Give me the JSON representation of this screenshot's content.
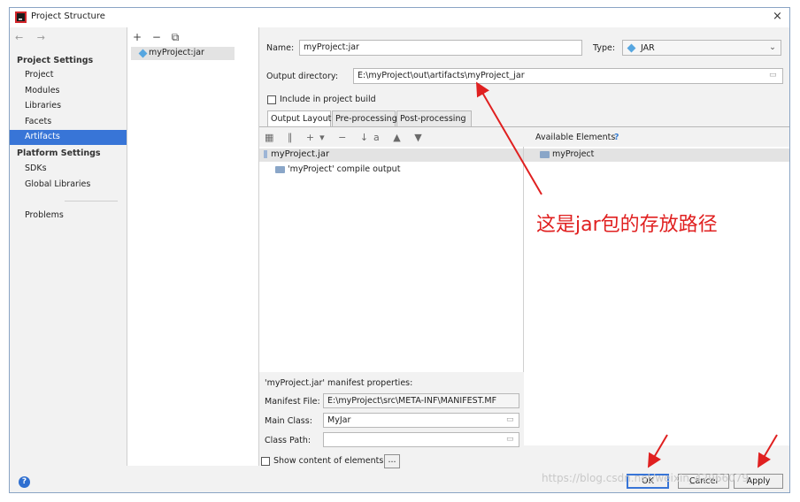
{
  "window": {
    "title": "Project Structure",
    "close_glyph": "×"
  },
  "nav": {
    "back_forward": "← →",
    "project_settings_header": "Project Settings",
    "project_settings": [
      "Project",
      "Modules",
      "Libraries",
      "Facets",
      "Artifacts"
    ],
    "selected": "Artifacts",
    "platform_settings_header": "Platform Settings",
    "platform_settings": [
      "SDKs",
      "Global Libraries"
    ],
    "problems": "Problems"
  },
  "artifacts_list": {
    "toolbar": "+ − ⧉",
    "items": [
      "myProject:jar"
    ]
  },
  "form": {
    "name_label": "Name:",
    "name_value": "myProject:jar",
    "type_label": "Type:",
    "type_value": "JAR",
    "output_dir_label": "Output directory:",
    "output_dir_value": "E:\\myProject\\out\\artifacts\\myProject_jar",
    "include_in_build_label": "Include in project build",
    "include_in_build_checked": false
  },
  "tabs": [
    {
      "label": "Output Layout",
      "active": true
    },
    {
      "label": "Pre-processing",
      "active": false
    },
    {
      "label": "Post-processing",
      "active": false
    }
  ],
  "layout_tree": {
    "toolbar": "▦ ∥ +▾ − ↓a ▲ ▼",
    "items": [
      {
        "label": "myProject.jar"
      },
      {
        "label": "'myProject' compile output"
      }
    ]
  },
  "available": {
    "label": "Available Elements",
    "help": "?",
    "items": [
      "myProject"
    ]
  },
  "manifest": {
    "title": "'myProject.jar' manifest properties:",
    "file_label": "Manifest File:",
    "file_value": "E:\\myProject\\src\\META-INF\\MANIFEST.MF",
    "main_class_label": "Main Class:",
    "main_class_value": "MyJar",
    "class_path_label": "Class Path:",
    "class_path_value": ""
  },
  "show_content": {
    "label": "Show content of elements",
    "checked": false,
    "more_button": "..."
  },
  "buttons": {
    "ok": "OK",
    "cancel": "Cancel",
    "apply": "Apply",
    "help": "?"
  },
  "annotation": {
    "text": "这是jar包的存放路径",
    "color": "#e02020"
  },
  "watermark": "https://blog.csdn.net/weixin_42966079",
  "colors": {
    "selection": "#3875d7",
    "annotation": "#e02020"
  }
}
